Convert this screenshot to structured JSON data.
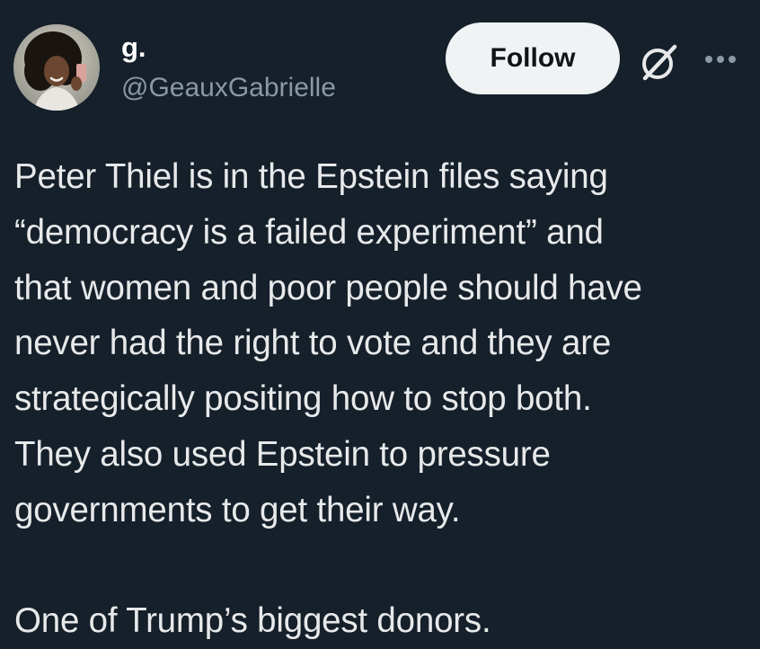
{
  "author": {
    "display_name": "g.",
    "handle": "@GeauxGabrielle"
  },
  "actions": {
    "follow_label": "Follow",
    "grok_icon": "grok-slash-circle-icon",
    "more_icon": "more-dots-icon"
  },
  "tweet": {
    "paragraph1": [
      "Peter Thiel is in the Epstein files saying",
      "“democracy is a failed experiment” and",
      "that women and poor people should have",
      "never had the right to vote and they are",
      "strategically positing how to stop both.",
      "They also used Epstein to pressure",
      "governments to get their way."
    ],
    "paragraph2": "One of Trump’s biggest donors."
  },
  "colors": {
    "background": "#15202b",
    "text": "#e7e9ea",
    "secondary_text": "#8b98a5",
    "follow_button_bg": "#eff3f4",
    "follow_button_text": "#0f1419"
  }
}
